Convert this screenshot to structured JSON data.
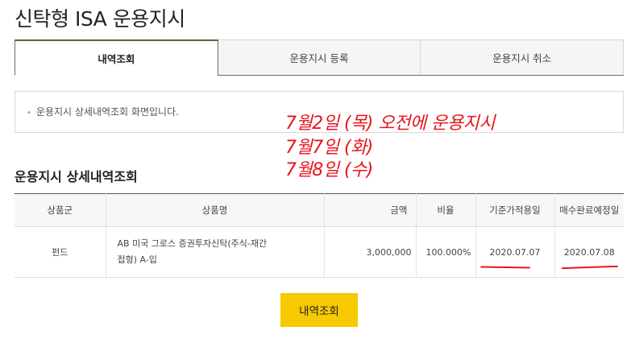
{
  "page": {
    "title": "신탁형 ISA 운용지시"
  },
  "tabs": [
    {
      "label": "내역조회",
      "active": true
    },
    {
      "label": "운용지시 등록",
      "active": false
    },
    {
      "label": "운용지시 취소",
      "active": false
    }
  ],
  "info": {
    "bullet": "•",
    "text": "운용지시 상세내역조회 화면입니다."
  },
  "annotations": {
    "line1": "7월2일 (목) 오전에 운용지시",
    "line2": "7월7일 (화)",
    "line3": "7월8일 (수)",
    "color": "#e8141c"
  },
  "section": {
    "title": "운용지시 상세내역조회"
  },
  "table": {
    "headers": {
      "category": "상품군",
      "product": "상품명",
      "amount": "금액",
      "ratio": "비율",
      "base_date": "기준가적용일",
      "settle_date": "매수완료예정일"
    },
    "rows": [
      {
        "category": "펀드",
        "product_line1": "AB 미국 그로스 증권투자신탁(주식-재간",
        "product_line2": "접형) A-입",
        "amount": "3,000,000",
        "ratio": "100.000%",
        "base_date": "2020.07.07",
        "settle_date": "2020.07.08"
      }
    ]
  },
  "button": {
    "label": "내역조회",
    "color": "#f6c900"
  },
  "colors": {
    "accent_border": "#7a6a55"
  }
}
